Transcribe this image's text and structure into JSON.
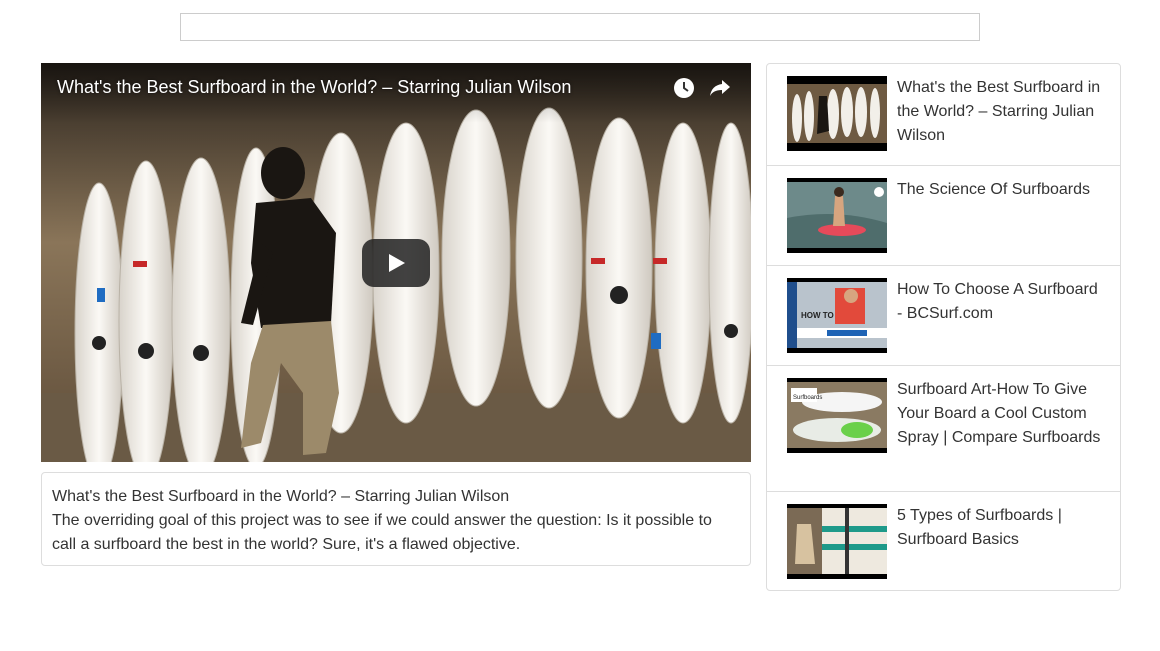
{
  "search": {
    "value": "",
    "placeholder": ""
  },
  "player": {
    "title": "What's the Best Surfboard in the World? – Starring Julian Wilson",
    "icons": {
      "watch_later": "clock-icon",
      "share": "share-arrow-icon",
      "play": "play-icon"
    }
  },
  "description": {
    "title": "What's the Best Surfboard in the World? – Starring Julian Wilson",
    "text": "The overriding goal of this project was to see if we could answer the question: Is it possible to call a surfboard the best in the world? Sure, it's a flawed objective."
  },
  "playlist": [
    {
      "title": "What's the Best Surfboard in the World? – Starring Julian Wilson"
    },
    {
      "title": "The Science Of Surfboards"
    },
    {
      "title": "How To Choose A Surfboard - BCSurf.com",
      "thumb_text": "HOW TO"
    },
    {
      "title": "Surfboard Art-How To Give Your Board a Cool Custom Spray | Compare Surfboards",
      "thumb_text": "Surfboards"
    },
    {
      "title": "5 Types of Surfboards | Surfboard Basics"
    }
  ],
  "colors": {
    "border": "#dddddd",
    "text": "#333333",
    "overlay": "#212121"
  }
}
